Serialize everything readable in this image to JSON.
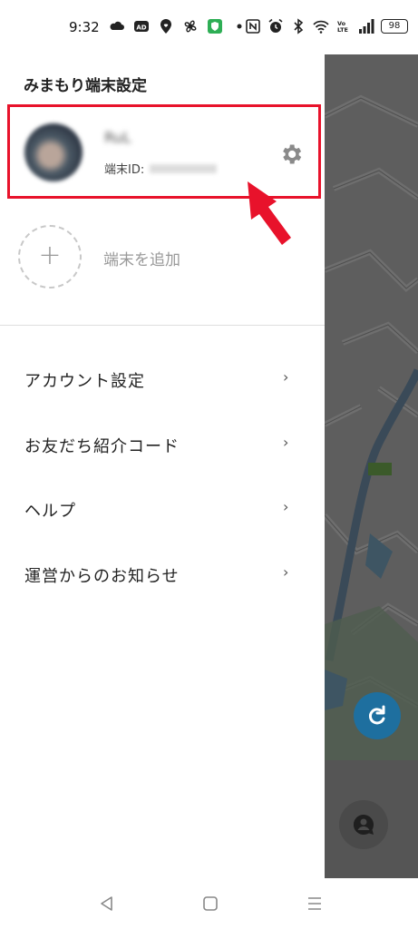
{
  "status_bar": {
    "time": "9:32",
    "battery": "98",
    "icons_left": [
      "cloud-icon",
      "ad-icon",
      "location-heart-icon",
      "fan-icon",
      "shield-check-icon",
      "dot-icon"
    ],
    "icons_right": [
      "nfc-icon",
      "alarm-icon",
      "bluetooth-icon",
      "wifi-icon",
      "volte-icon",
      "signal-icon",
      "battery-icon"
    ]
  },
  "drawer": {
    "title": "みまもり端末設定",
    "device": {
      "name": "RuL",
      "id_label": "端末ID:",
      "id_value": "",
      "settings_icon": "gear-icon"
    },
    "add_device_label": "端末を追加",
    "add_icon": "+",
    "menu": [
      {
        "label": "アカウント設定",
        "chevron": "›"
      },
      {
        "label": "お友だち紹介コード",
        "chevron": "›"
      },
      {
        "label": "ヘルプ",
        "chevron": "›"
      },
      {
        "label": "運営からのお知らせ",
        "chevron": "›"
      }
    ]
  },
  "map": {
    "refresh_icon": "refresh-icon",
    "chat_icon": "person-chat-icon"
  },
  "nav": {
    "back_icon": "back-triangle-icon",
    "home_icon": "home-square-icon",
    "recent_icon": "recent-menu-icon"
  },
  "colors": {
    "highlight": "#e8122b",
    "accent": "#1e6f9f",
    "map_overlay": "#5d5d5d"
  }
}
